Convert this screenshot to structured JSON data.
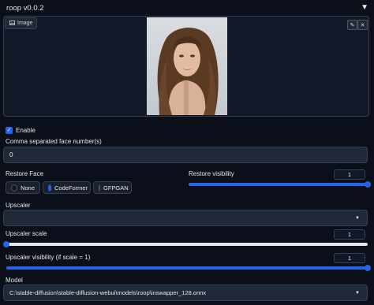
{
  "panel": {
    "title": "roop v0.0.2",
    "collapse_icon": "triangle-down-icon"
  },
  "image": {
    "tag_label": "Image",
    "tag_icon": "image-icon",
    "edit_icon": "pencil-icon",
    "clear_icon": "close-icon"
  },
  "enable": {
    "label": "Enable",
    "checked": true
  },
  "face_numbers": {
    "label": "Comma separated face number(s)",
    "value": "0"
  },
  "restore_face": {
    "label": "Restore Face",
    "options": [
      "None",
      "CodeFormer",
      "GFPGAN"
    ],
    "selected": "CodeFormer"
  },
  "restore_visibility": {
    "label": "Restore visibility",
    "value": "1",
    "fraction": 1.0
  },
  "upscaler": {
    "label": "Upscaler",
    "value": ""
  },
  "upscaler_scale": {
    "label": "Upscaler scale",
    "value": "1",
    "fraction": 0.0
  },
  "upscaler_visibility": {
    "label": "Upscaler visibility (if scale = 1)",
    "value": "1",
    "fraction": 1.0
  },
  "model": {
    "label": "Model",
    "value": "C:\\stable-diffusion\\stable-diffusion-webui\\models\\roop\\inswapper_128.onnx"
  },
  "colors": {
    "accent": "#2563eb",
    "background": "#0b0f19",
    "input_bg": "#1f2937",
    "border": "#374151"
  }
}
